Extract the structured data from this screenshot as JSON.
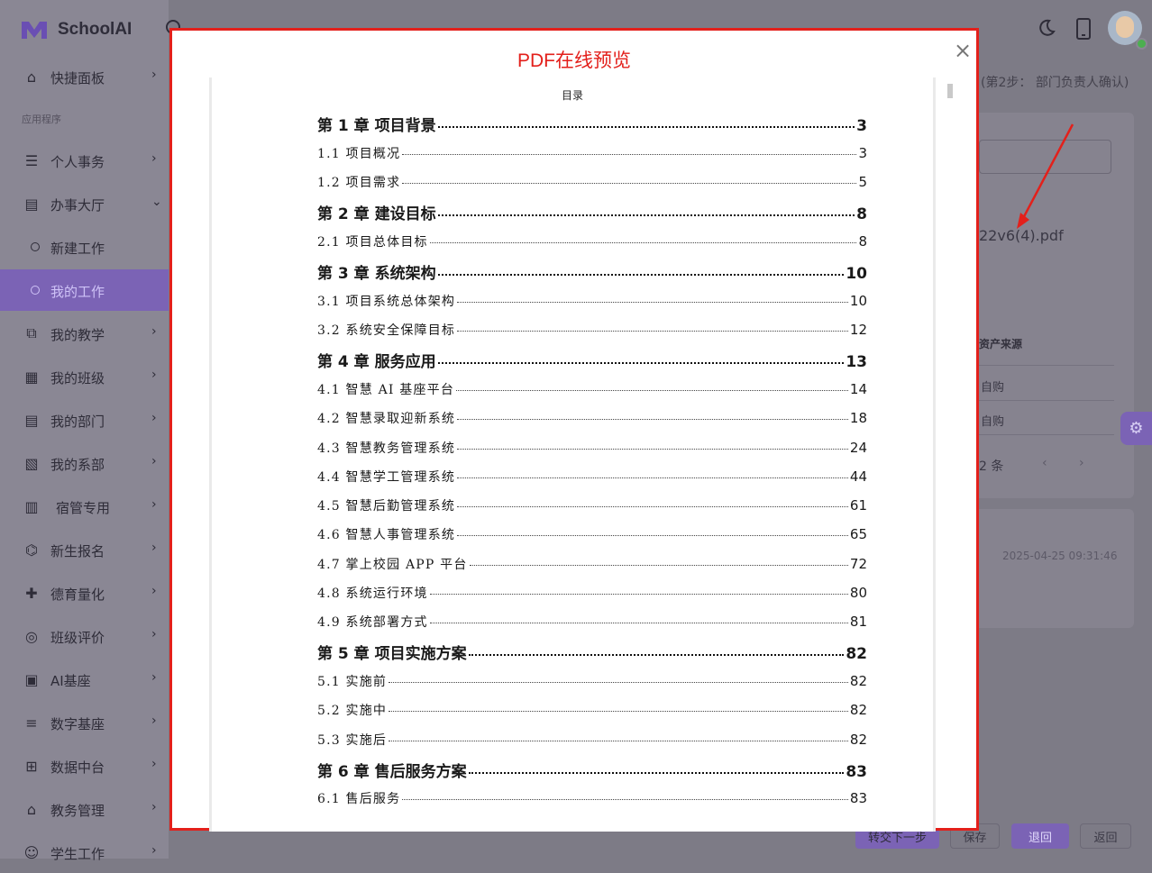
{
  "app": {
    "name": "SchoolAI"
  },
  "sidebar": {
    "section_label": "应用程序",
    "items": [
      {
        "label": "快捷面板",
        "icon": "home-icon"
      },
      {
        "label": "个人事务",
        "icon": "list-icon"
      },
      {
        "label": "办事大厅",
        "icon": "document-icon"
      },
      {
        "label": "新建工作",
        "icon": "circle-icon"
      },
      {
        "label": "我的工作",
        "icon": "circle-icon"
      },
      {
        "label": "我的教学",
        "icon": "teaching-icon"
      },
      {
        "label": "我的班级",
        "icon": "class-icon"
      },
      {
        "label": "我的部门",
        "icon": "department-icon"
      },
      {
        "label": "我的系部",
        "icon": "faculty-icon"
      },
      {
        "label": "宿管专用",
        "icon": "building-icon"
      },
      {
        "label": "新生报名",
        "icon": "graduation-icon"
      },
      {
        "label": "德育量化",
        "icon": "user-add-icon"
      },
      {
        "label": "班级评价",
        "icon": "rating-icon"
      },
      {
        "label": "AI基座",
        "icon": "chip-icon"
      },
      {
        "label": "数字基座",
        "icon": "database-icon"
      },
      {
        "label": "数据中台",
        "icon": "data-center-icon"
      },
      {
        "label": "教务管理",
        "icon": "academic-icon"
      },
      {
        "label": "学生工作",
        "icon": "student-icon"
      }
    ]
  },
  "background": {
    "step_text": "(第2步： 部门负责人确认)",
    "file_name": "22v6(4).pdf",
    "column_header": "资产来源",
    "cells": [
      "自购",
      "自购"
    ],
    "count_text": "2 条",
    "date": "2025-04-25 09:31:46",
    "buttons": {
      "next": "转交下一步",
      "save": "保存",
      "back": "退回",
      "return": "返回"
    }
  },
  "modal": {
    "title": "PDF在线预览",
    "close": "×",
    "toc_heading": "目录",
    "toc": [
      {
        "type": "ch",
        "text": "第 1 章  项目背景",
        "page": "3"
      },
      {
        "type": "sec",
        "text": "1.1 项目概况",
        "page": "3"
      },
      {
        "type": "sec",
        "text": "1.2 项目需求",
        "page": "5"
      },
      {
        "type": "ch",
        "text": "第 2 章  建设目标",
        "page": "8"
      },
      {
        "type": "sec",
        "text": "2.1 项目总体目标",
        "page": "8"
      },
      {
        "type": "ch",
        "text": "第 3 章  系统架构",
        "page": "10"
      },
      {
        "type": "sec",
        "text": "3.1 项目系统总体架构",
        "page": "10"
      },
      {
        "type": "sec",
        "text": "3.2 系统安全保障目标",
        "page": "12"
      },
      {
        "type": "ch",
        "text": "第 4 章  服务应用",
        "page": "13"
      },
      {
        "type": "sec",
        "text": "4.1 智慧 AI 基座平台",
        "page": "14"
      },
      {
        "type": "sec",
        "text": "4.2 智慧录取迎新系统",
        "page": "18"
      },
      {
        "type": "sec",
        "text": "4.3 智慧教务管理系统",
        "page": "24"
      },
      {
        "type": "sec",
        "text": "4.4 智慧学工管理系统",
        "page": "44"
      },
      {
        "type": "sec",
        "text": "4.5 智慧后勤管理系统",
        "page": "61"
      },
      {
        "type": "sec",
        "text": "4.6 智慧人事管理系统",
        "page": "65"
      },
      {
        "type": "sec",
        "text": "4.7 掌上校园 APP 平台",
        "page": "72"
      },
      {
        "type": "sec",
        "text": "4.8 系统运行环境",
        "page": "80"
      },
      {
        "type": "sec",
        "text": "4.9 系统部署方式",
        "page": "81"
      },
      {
        "type": "ch",
        "text": "第 5 章  项目实施方案",
        "page": "82"
      },
      {
        "type": "sec",
        "text": "5.1 实施前",
        "page": "82"
      },
      {
        "type": "sec",
        "text": "5.2 实施中",
        "page": "82"
      },
      {
        "type": "sec",
        "text": "5.3 实施后",
        "page": "82"
      },
      {
        "type": "ch",
        "text": "第 6 章  售后服务方案",
        "page": "83"
      },
      {
        "type": "sec",
        "text": "6.1 售后服务",
        "page": "83"
      }
    ]
  },
  "colors": {
    "accent": "#7b63b5",
    "modal_border": "#e3201b",
    "title": "#e3201b"
  }
}
